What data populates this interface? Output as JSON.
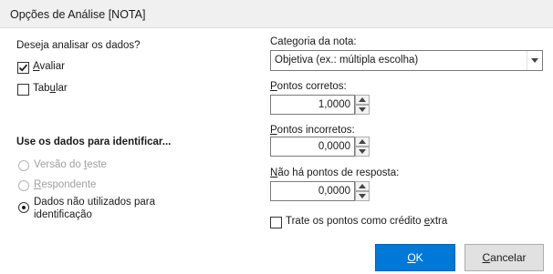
{
  "window": {
    "title": "Opções de Análise [NOTA]"
  },
  "analyze": {
    "heading": "Deseja analisar os dados?",
    "options": [
      {
        "pre": "",
        "key": "A",
        "post": "valiar",
        "checked": true
      },
      {
        "pre": "Tab",
        "key": "u",
        "post": "lar",
        "checked": false
      }
    ]
  },
  "identify": {
    "heading": "Use os dados para identificar...",
    "options": [
      {
        "pre": "Versão do ",
        "key": "t",
        "post": "este",
        "enabled": false,
        "selected": false
      },
      {
        "pre": "",
        "key": "R",
        "post": "espondente",
        "enabled": false,
        "selected": false
      },
      {
        "line1": "Dados não utilizados para",
        "line2": "identificação",
        "enabled": true,
        "selected": true
      }
    ]
  },
  "category": {
    "label": "Categoria da nota:",
    "value": "Objetiva (ex.: múltipla escolha)"
  },
  "points": [
    {
      "pre": "",
      "key": "P",
      "post": "ontos corretos:",
      "value": "1,0000"
    },
    {
      "pre": "",
      "key": "P",
      "post": "ontos incorretos:",
      "value": "0,0000"
    },
    {
      "pre": "",
      "key": "N",
      "post": "ão há pontos de resposta:",
      "value": "0,0000"
    }
  ],
  "extra_credit": {
    "pre": "Trate os pontos como crédito ",
    "key": "e",
    "post": "xtra",
    "checked": false
  },
  "buttons": {
    "ok": {
      "key": "O",
      "post": "K"
    },
    "cancel": {
      "key": "C",
      "post": "ancelar"
    }
  },
  "colors": {
    "primary_button": "#0078d7",
    "disabled_text": "#a0a0a0"
  }
}
